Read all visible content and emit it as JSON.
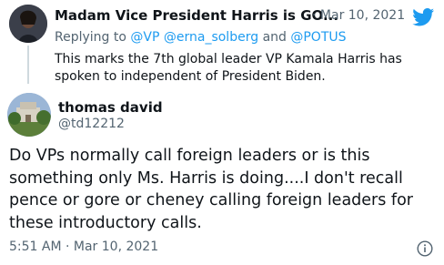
{
  "parent_tweet": {
    "display_name": "Madam Vice President Harris is GO...",
    "separator": "·",
    "date": "Mar 10, 2021",
    "replying_prefix": "Replying to",
    "mentions": [
      "@VP",
      "@erna_solberg",
      "@POTUS"
    ],
    "and_word": "and",
    "text_line1": "This marks the 7th global leader VP Kamala Harris has",
    "text_line2": "spoken to independent of President Biden."
  },
  "reply_tweet": {
    "display_name": "thomas david",
    "handle": "@td12212",
    "text_line1": "Do VPs normally call foreign leaders or is this",
    "text_line2": "something only Ms. Harris is doing....I don't recall",
    "text_line3": "pence or gore or cheney calling foreign leaders for",
    "text_line4": "these introductory calls.",
    "timestamp": "5:51 AM · Mar 10, 2021"
  },
  "icons": {
    "brand": "twitter-bird-icon",
    "info": "info-icon"
  },
  "colors": {
    "link": "#1d9bf0",
    "secondary_text": "#536471",
    "primary_text": "#0f1419",
    "thread_line": "#cfd9de"
  }
}
